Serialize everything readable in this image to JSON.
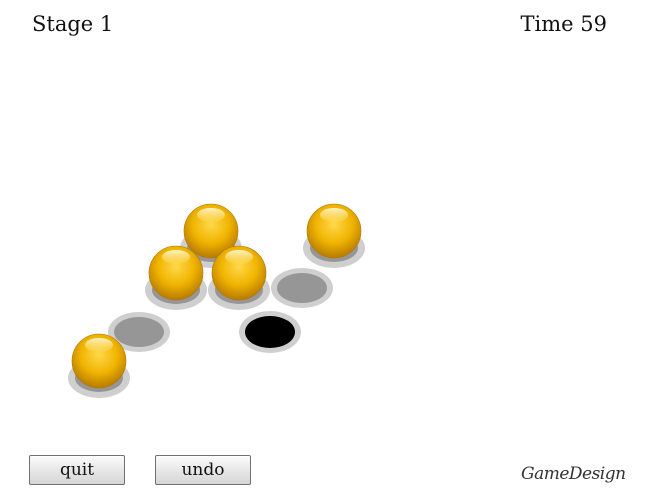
{
  "hud": {
    "stage_label": "Stage 1",
    "time_label": "Time 59"
  },
  "buttons": {
    "quit_label": "quit",
    "undo_label": "undo"
  },
  "logo_text": "GameDesign",
  "colors": {
    "ball": "#e8ac00",
    "ball_highlight": "#ffe79a",
    "hole": "#969696",
    "hole_ring": "#cfcfcf",
    "target_hole": "#000000"
  },
  "board": {
    "holes": [
      {
        "id": "h1",
        "type": "ball"
      },
      {
        "id": "h2",
        "type": "ball"
      },
      {
        "id": "h3",
        "type": "ball"
      },
      {
        "id": "h4",
        "type": "ball"
      },
      {
        "id": "h5",
        "type": "empty"
      },
      {
        "id": "h6",
        "type": "empty"
      },
      {
        "id": "h7",
        "type": "target"
      },
      {
        "id": "h8",
        "type": "ball"
      }
    ]
  }
}
